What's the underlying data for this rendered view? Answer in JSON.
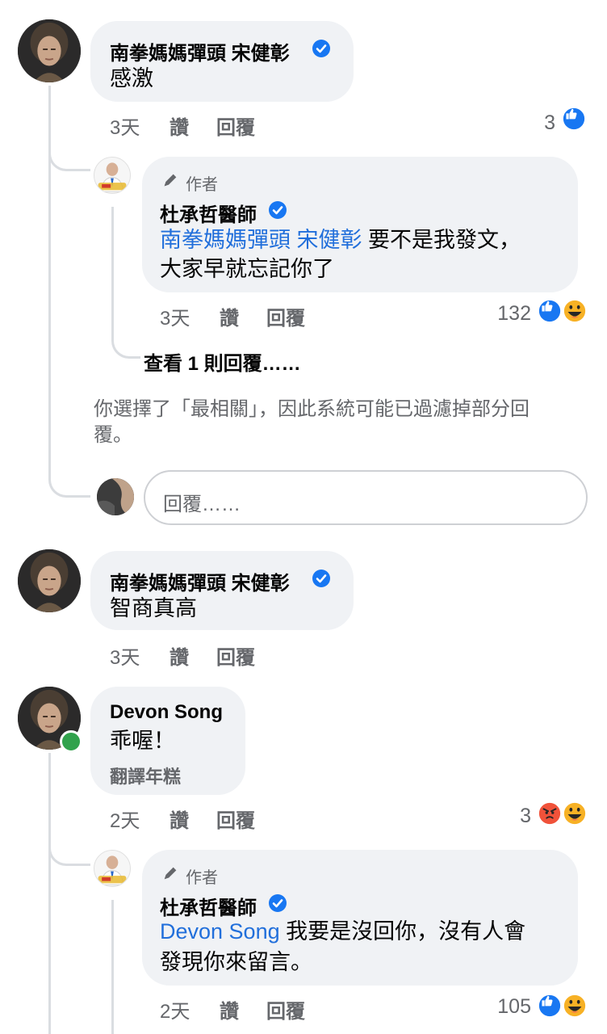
{
  "comments": {
    "c1": {
      "author": "南拳媽媽彈頭  宋健彰",
      "text": "感激",
      "time": "3天",
      "like": "讚",
      "reply": "回覆",
      "reactions": "3",
      "reaction_icons": [
        "like-icon"
      ]
    },
    "r1": {
      "author_tag": "作者",
      "author": "杜承哲醫師",
      "mention": "南拳媽媽彈頭  宋健彰",
      "text_line1": " 要不是我發文，",
      "text_line2": "大家早就忘記你了",
      "time": "3天",
      "like": "讚",
      "reply": "回覆",
      "reactions": "132",
      "reaction_icons": [
        "like-icon",
        "haha-icon"
      ]
    },
    "view_more": "查看 1 則回覆……",
    "filter_note_line1": "你選擇了「最相關」，因此系統可能已過濾掉部分回",
    "filter_note_line2": "覆。",
    "reply_placeholder": "回覆……",
    "c2": {
      "author": "南拳媽媽彈頭  宋健彰",
      "text": "智商真高",
      "time": "3天",
      "like": "讚",
      "reply": "回覆"
    },
    "c3": {
      "author": "Devon Song",
      "text": "乖喔！",
      "translate": "翻譯年糕",
      "time": "2天",
      "like": "讚",
      "reply": "回覆",
      "reactions": "3",
      "reaction_icons": [
        "angry-icon",
        "haha-icon"
      ]
    },
    "r2": {
      "author_tag": "作者",
      "author": "杜承哲醫師",
      "mention": "Devon Song",
      "text_line1": " 我要是沒回你，沒有人會",
      "text_line2": "發現你來留言。",
      "time": "2天",
      "like": "讚",
      "reply": "回覆",
      "reactions": "105",
      "reaction_icons": [
        "like-icon",
        "haha-icon"
      ]
    }
  },
  "colors": {
    "bubble": "#f0f2f5",
    "mention": "#216fdb",
    "meta": "#65676b",
    "like": "#1877f2",
    "online": "#31a24c"
  }
}
